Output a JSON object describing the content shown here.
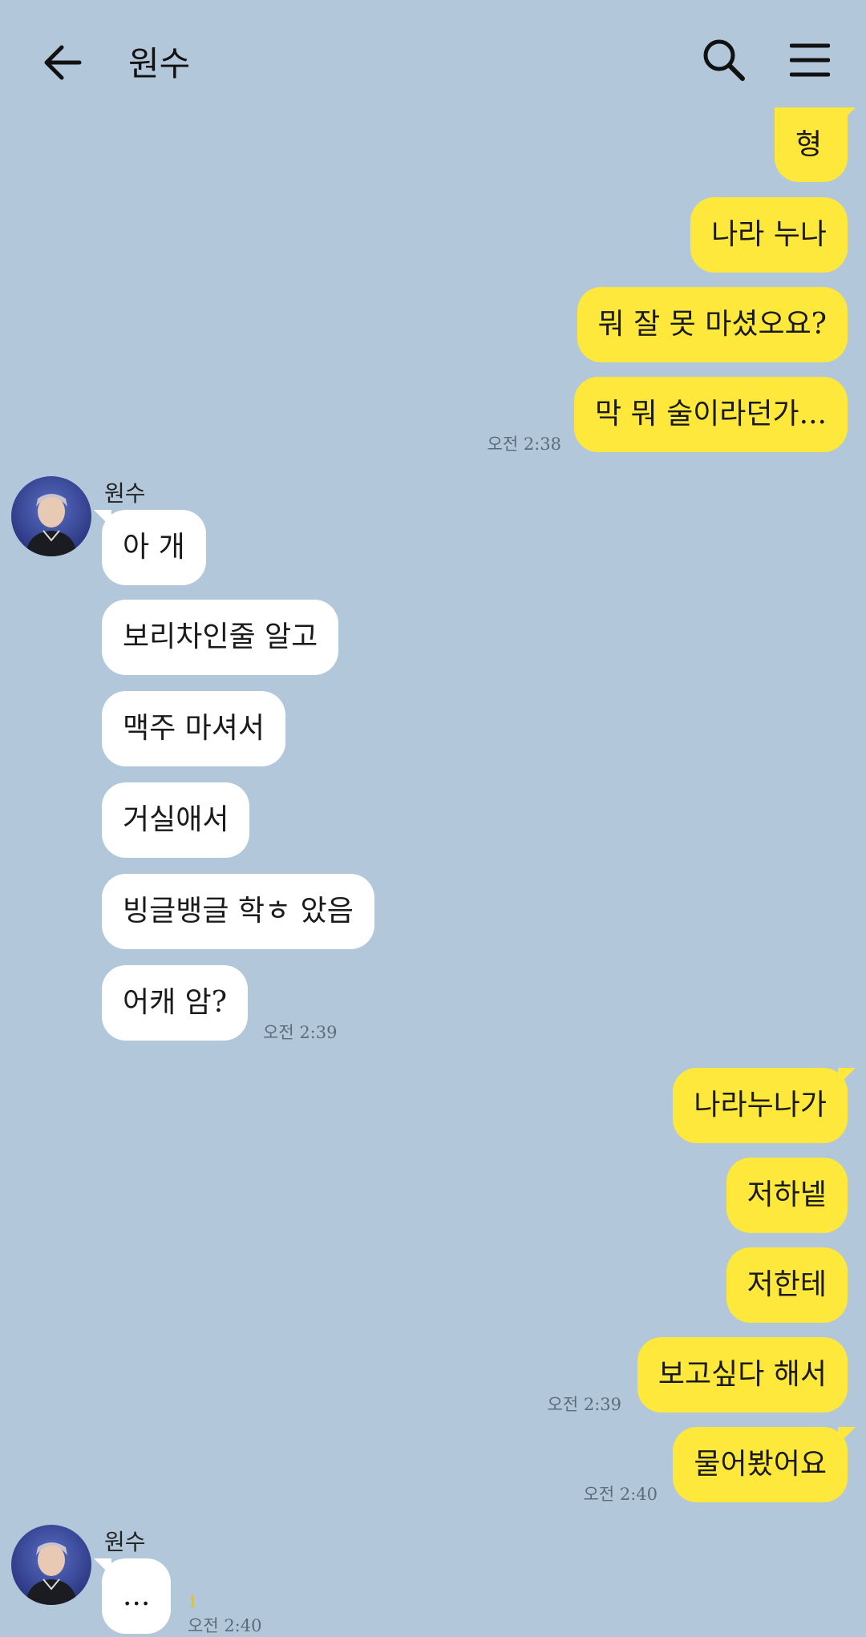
{
  "header": {
    "title": "원수"
  },
  "messages": {
    "m1": "형",
    "m2": "나라 누나",
    "m3": "뭐 잘 못 마셨오요?",
    "m4": "막 뭐 술이라던가...",
    "t1": "오전 2:38",
    "sender1": "원수",
    "r1": "아 개",
    "r2": "보리차인줄 알고",
    "r3": "맥주 마셔서",
    "r4": "거실애서",
    "r5": "빙글뱅글 학ㅎ 았음",
    "r6": "어캐 암?",
    "t2": "오전 2:39",
    "m5": "나라누나가",
    "m6": "저하넽",
    "m7": "저한테",
    "m8": "보고싶다 해서",
    "t3": "오전 2:39",
    "m9": "물어봤어요",
    "t4": "오전 2:40",
    "sender2": "원수",
    "r7": "...",
    "unread": "1",
    "t5": "오전 2:40"
  },
  "colors": {
    "background": "#b2c7da",
    "my_bubble": "#fee83b",
    "their_bubble": "#ffffff"
  }
}
